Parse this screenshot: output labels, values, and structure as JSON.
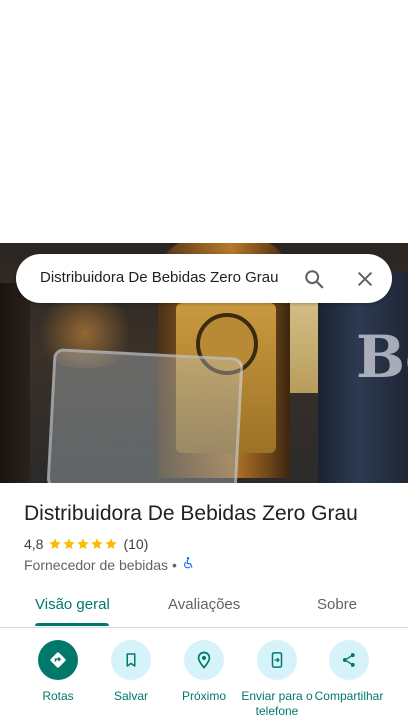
{
  "search": {
    "query": "Distribuidora De Bebidas Zero Grau"
  },
  "place": {
    "name": "Distribuidora De Bebidas Zero Grau",
    "rating": "4,8",
    "star_count": 5,
    "reviews_count": "(10)",
    "category": "Fornecedor de bebidas",
    "separator": "•",
    "photo_text": "Bo"
  },
  "tabs": [
    {
      "label": "Visão geral",
      "active": true
    },
    {
      "label": "Avaliações",
      "active": false
    },
    {
      "label": "Sobre",
      "active": false
    }
  ],
  "actions": [
    {
      "label": "Rotas",
      "icon": "directions-icon"
    },
    {
      "label": "Salvar",
      "icon": "bookmark-icon"
    },
    {
      "label": "Próximo",
      "icon": "nearby-icon"
    },
    {
      "label": "Enviar para o telefone",
      "icon": "send-to-phone-icon"
    },
    {
      "label": "Compartilhar",
      "icon": "share-icon"
    }
  ],
  "colors": {
    "accent": "#00796b",
    "star": "#fbbc04",
    "action_bg": "#d7f3fa",
    "accessibility": "#1a73e8"
  }
}
